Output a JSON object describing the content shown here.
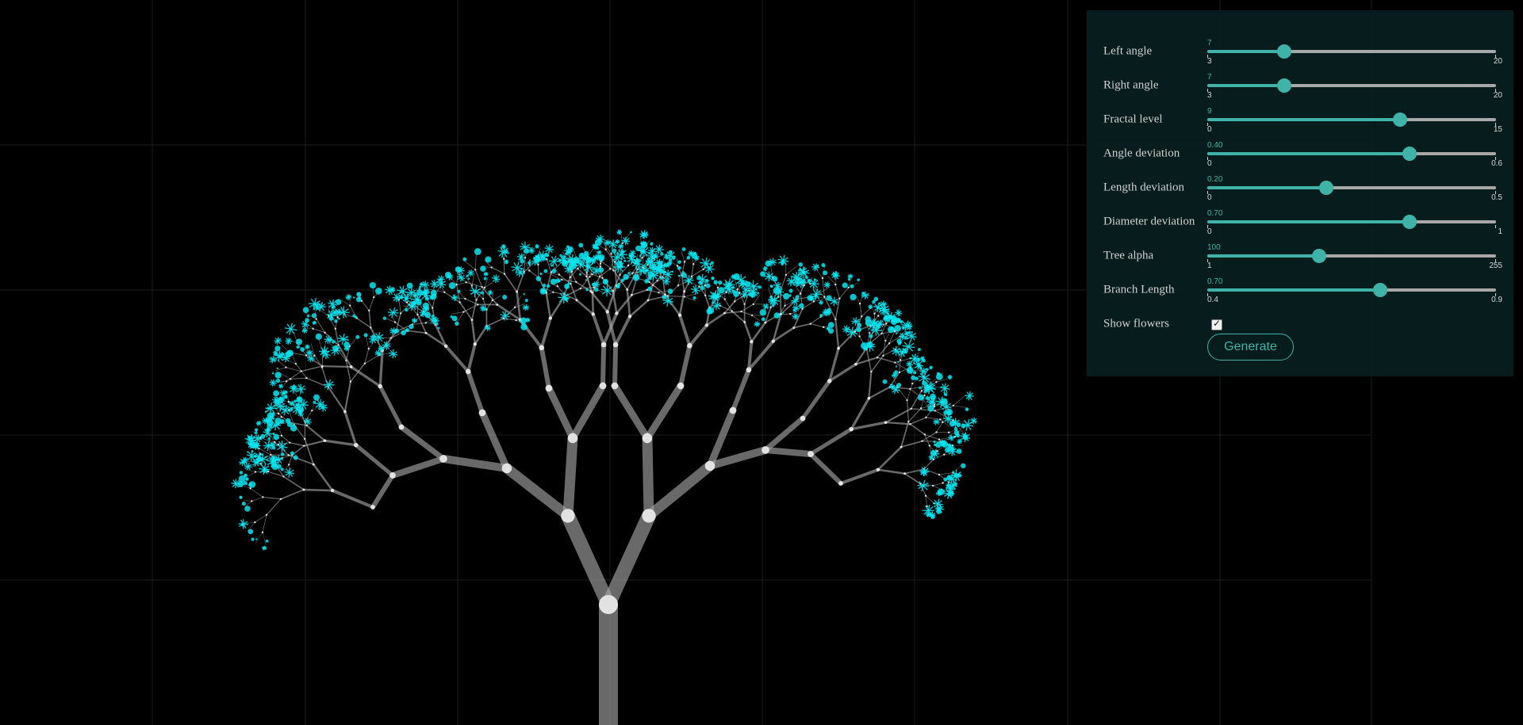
{
  "controls": {
    "sliders": [
      {
        "label": "Left angle",
        "value": "7",
        "min": "3",
        "max": "20",
        "fraction": 0.2667
      },
      {
        "label": "Right angle",
        "value": "7",
        "min": "3",
        "max": "20",
        "fraction": 0.2667
      },
      {
        "label": "Fractal level",
        "value": "9",
        "min": "0",
        "max": "15",
        "fraction": 0.6667
      },
      {
        "label": "Angle deviation",
        "value": "0.40",
        "min": "0",
        "max": "0.6",
        "fraction": 0.7
      },
      {
        "label": "Length deviation",
        "value": "0.20",
        "min": "0",
        "max": "0.5",
        "fraction": 0.4133
      },
      {
        "label": "Diameter deviation",
        "value": "0.70",
        "min": "0",
        "max": "1",
        "fraction": 0.7
      },
      {
        "label": "Tree alpha",
        "value": "100",
        "min": "1",
        "max": "255",
        "fraction": 0.3867
      },
      {
        "label": "Branch Length",
        "value": "0.70",
        "min": "0.4",
        "max": "0.9",
        "fraction": 0.6
      }
    ],
    "show_flowers": {
      "label": "Show flowers",
      "checked": true
    },
    "generate_label": "Generate"
  },
  "colors": {
    "accent": "#3fb3a8",
    "flower": "#00e5f0",
    "branch": "#8a8a8a",
    "knot": "#e6e6e6",
    "background": "#000000",
    "panel": "#081e1e"
  },
  "icons": {
    "checkmark": "checkmark-icon"
  }
}
